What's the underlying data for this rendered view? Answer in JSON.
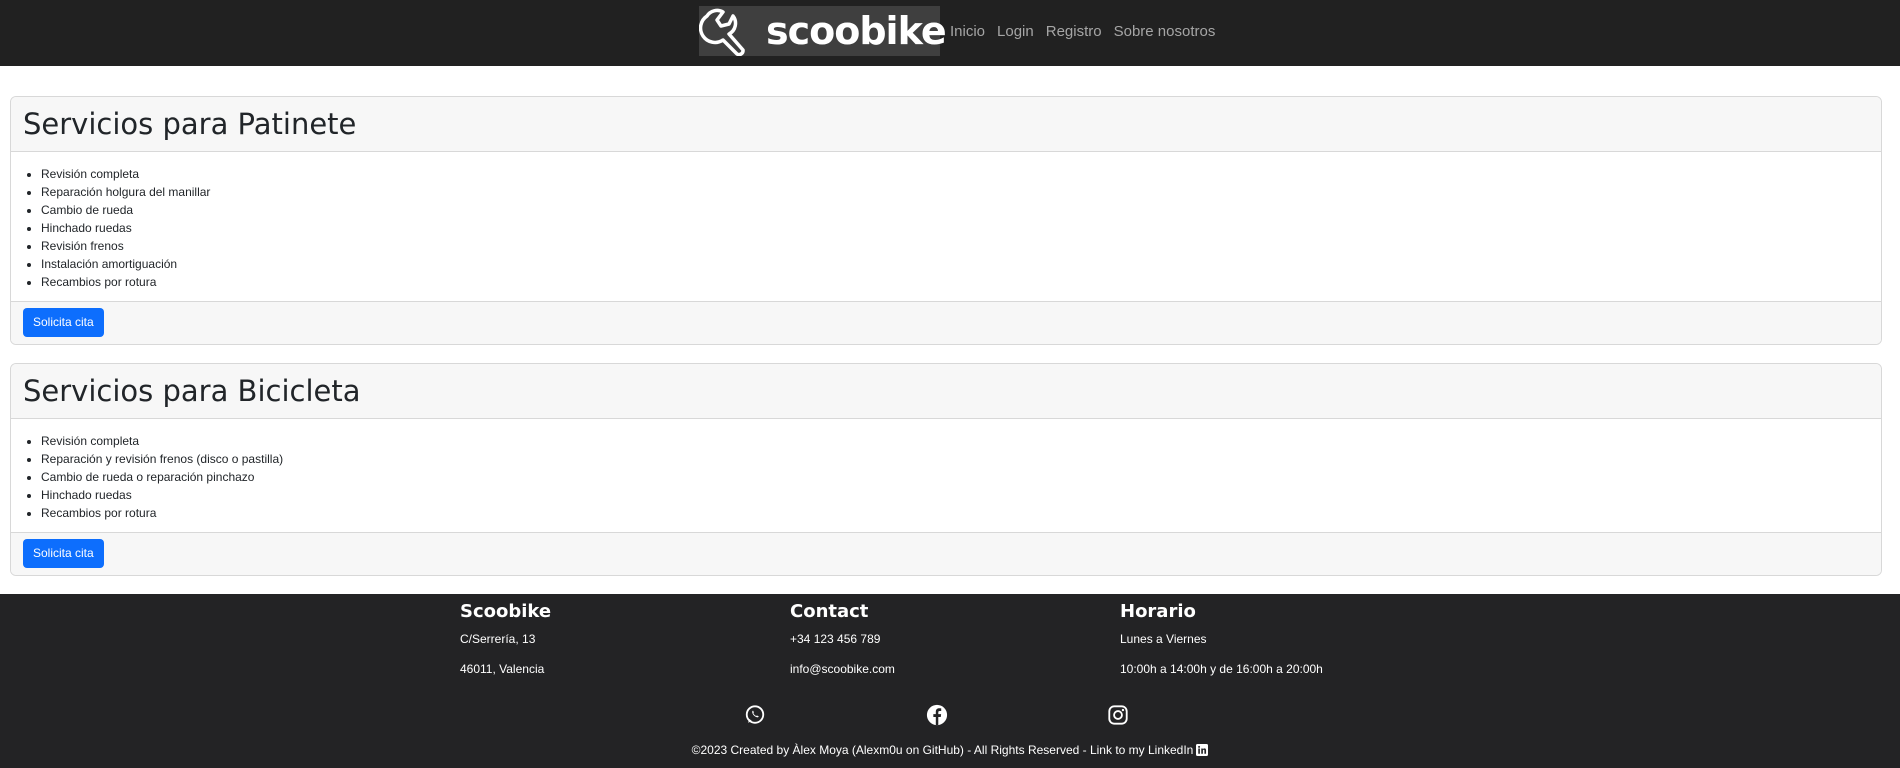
{
  "navbar": {
    "brand": "scoobike",
    "brand_icon": "wrench-icon",
    "links": [
      "Inicio",
      "Login",
      "Registro",
      "Sobre nosotros"
    ]
  },
  "cards": [
    {
      "title": "Servicios para Patinete",
      "items": [
        "Revisión completa",
        "Reparación holgura del manillar",
        "Cambio de rueda",
        "Hinchado ruedas",
        "Revisión frenos",
        "Instalación amortiguación",
        "Recambios por rotura"
      ],
      "button": "Solicita cita"
    },
    {
      "title": "Servicios para Bicicleta",
      "items": [
        "Revisión completa",
        "Reparación y revisión frenos (disco o pastilla)",
        "Cambio de rueda o reparación pinchazo",
        "Hinchado ruedas",
        "Recambios por rotura"
      ],
      "button": "Solicita cita"
    }
  ],
  "footer": {
    "columns": [
      {
        "title": "Scoobike",
        "lines": [
          "C/Serrería, 13",
          "46011, Valencia"
        ]
      },
      {
        "title": "Contact",
        "lines": [
          "+34 123 456 789",
          "info@scoobike.com"
        ]
      },
      {
        "title": "Horario",
        "lines": [
          "Lunes a Viernes",
          "10:00h a 14:00h y de 16:00h a 20:00h"
        ]
      }
    ],
    "social_icons": [
      "whatsapp-icon",
      "facebook-icon",
      "instagram-icon"
    ],
    "copyright": "©2023 Created by Àlex Moya (Alexm0u on GitHub) - All Rights Reserved - ",
    "linkedin_text": "Link to my LinkedIn",
    "linkedin_icon": "linkedin-icon"
  },
  "colors": {
    "navbar_bg": "#212121",
    "footer_bg": "#232325",
    "button_bg": "#0d6efd",
    "card_header_bg": "#f7f7f7"
  }
}
